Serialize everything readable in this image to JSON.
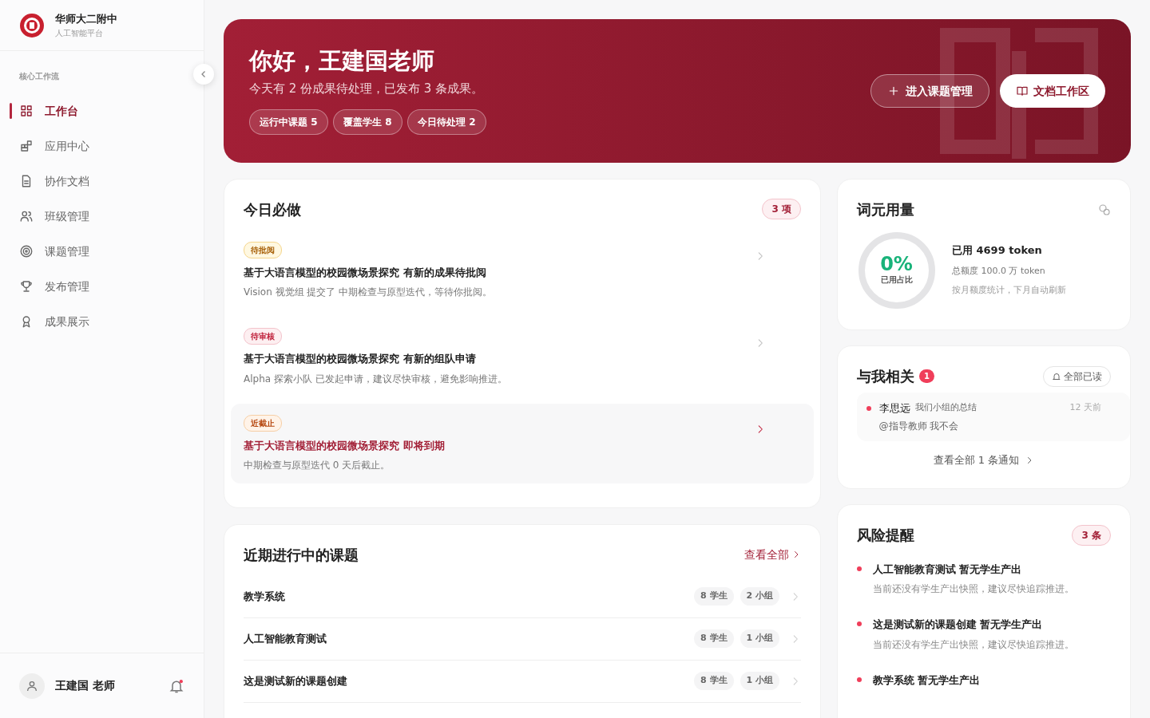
{
  "brand": {
    "name": "华师大二附中",
    "subtitle": "人工智能平台"
  },
  "sidebar": {
    "section": "核心工作流",
    "items": [
      {
        "label": "工作台",
        "selected": true
      },
      {
        "label": "应用中心",
        "selected": false
      },
      {
        "label": "协作文档",
        "selected": false
      },
      {
        "label": "班级管理",
        "selected": false
      },
      {
        "label": "课题管理",
        "selected": false
      },
      {
        "label": "发布管理",
        "selected": false
      },
      {
        "label": "成果展示",
        "selected": false
      }
    ],
    "user": "王建国 老师"
  },
  "hero": {
    "title": "你好，王建国老师",
    "subtitle": "今天有 2 份成果待处理，已发布 3 条成果。",
    "chips": [
      "运行中课题 5",
      "覆盖学生 8",
      "今日待处理 2"
    ],
    "buttons": [
      "进入课题管理",
      "文档工作区"
    ]
  },
  "todo": {
    "title": "今日必做",
    "count": "3 项",
    "items": [
      {
        "tag": "待批阅",
        "kind": "review",
        "title": "基于大语言模型的校园微场景探究 有新的成果待批阅",
        "desc": "Vision 视觉组 提交了 中期检查与原型迭代，等待你批阅。",
        "highlighted": false
      },
      {
        "tag": "待审核",
        "kind": "audit",
        "title": "基于大语言模型的校园微场景探究 有新的组队申请",
        "desc": "Alpha 探索小队 已发起申请，建议尽快审核，避免影响推进。",
        "highlighted": false
      },
      {
        "tag": "近截止",
        "kind": "deadline",
        "title": "基于大语言模型的校园微场景探究 即将到期",
        "desc": "中期检查与原型迭代 0 天后截止。",
        "highlighted": true
      }
    ]
  },
  "projects": {
    "title": "近期进行中的课题",
    "link": "查看全部",
    "rows": [
      {
        "name": "教学系统",
        "students": "8 学生",
        "groups": "2 小组"
      },
      {
        "name": "人工智能教育测试",
        "students": "8 学生",
        "groups": "1 小组"
      },
      {
        "name": "这是测试新的课题创建",
        "students": "8 学生",
        "groups": "1 小组"
      }
    ]
  },
  "usage": {
    "title": "词元用量",
    "percent": "0%",
    "percent_label": "已用占比",
    "used": "已用 4699 token",
    "quota": "总额度 100.0 万 token",
    "note": "按月额度统计，下月自动刷新"
  },
  "mentions": {
    "title": "与我相关",
    "badge": "1",
    "mark_all": "全部已读",
    "items": [
      {
        "author": "李思远",
        "topic": "我们小组的总结",
        "time": "12 天前",
        "text": "@指导教师 我不会",
        "unread": true
      }
    ],
    "footer": "查看全部 1 条通知"
  },
  "risks": {
    "title": "风险提醒",
    "count": "3 条",
    "items": [
      {
        "title": "人工智能教育测试 暂无学生产出",
        "desc": "当前还没有学生产出快照，建议尽快追踪推进。"
      },
      {
        "title": "这是测试新的课题创建 暂无学生产出",
        "desc": "当前还没有学生产出快照，建议尽快追踪推进。"
      },
      {
        "title": "教学系统 暂无学生产出"
      }
    ]
  }
}
